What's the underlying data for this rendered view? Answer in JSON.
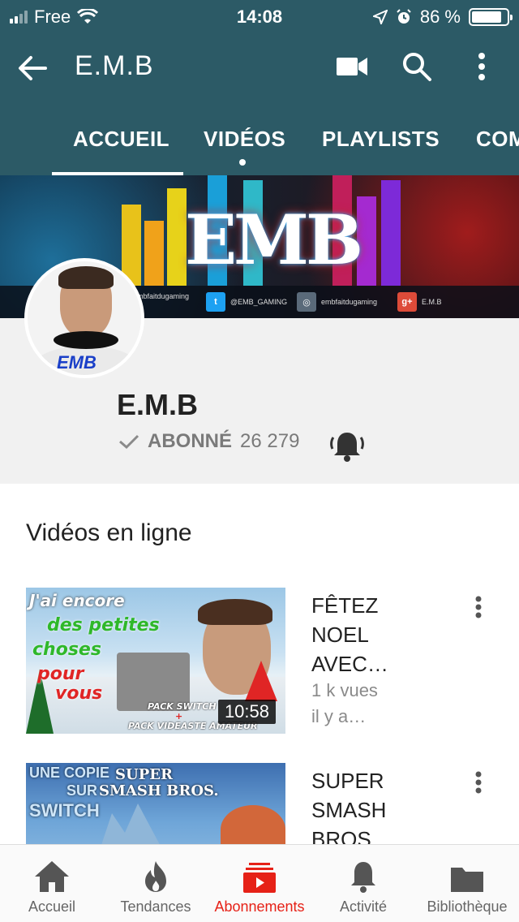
{
  "status_bar": {
    "carrier": "Free",
    "time": "14:08",
    "battery_percent": "86 %",
    "battery_level": 0.86
  },
  "app_bar": {
    "title": "E.M.B",
    "icons": [
      "back-arrow-icon",
      "video-camera-icon",
      "search-icon",
      "more-vert-icon"
    ]
  },
  "tabs": [
    {
      "label": "ACCUEIL",
      "active": true
    },
    {
      "label": "VIDÉOS",
      "has_dot": true
    },
    {
      "label": "PLAYLISTS"
    },
    {
      "label": "COM"
    }
  ],
  "banner": {
    "logo_text": "EMB",
    "socials": [
      {
        "icon": "facebook-icon",
        "handle": "embfaitdugaming"
      },
      {
        "icon": "twitter-icon",
        "handle": "@EMB_GAMING"
      },
      {
        "icon": "instagram-icon",
        "handle": "embfaitdugaming"
      },
      {
        "icon": "google-plus-icon",
        "handle": "E.M.B"
      }
    ]
  },
  "channel": {
    "name": "E.M.B",
    "avatar_logo": "EMB",
    "subscribed_label": "ABONNÉ",
    "subscriber_count": "26 279"
  },
  "section": {
    "title": "Vidéos en ligne"
  },
  "videos": [
    {
      "title_lines": [
        "FÊTEZ",
        "NOEL",
        "AVEC…"
      ],
      "views": "1 k vues",
      "age": "il y a…",
      "duration": "10:58",
      "thumb_text": [
        "J'ai encore",
        "des petites",
        "choses",
        "pour",
        "vous"
      ],
      "thumb_caption": [
        "PACK SWITCH",
        "+",
        "PACK VIDEASTE AMATEUR"
      ]
    },
    {
      "title_lines": [
        "SUPER",
        "SMASH",
        "BROS…"
      ],
      "thumb_text": [
        "UNE COPIE",
        "SUR",
        "SWITCH"
      ],
      "thumb_logo": [
        "SUPER",
        "SMASH BROS."
      ]
    }
  ],
  "bottom_nav": [
    {
      "label": "Accueil",
      "icon": "home-icon"
    },
    {
      "label": "Tendances",
      "icon": "flame-icon"
    },
    {
      "label": "Abonnements",
      "icon": "subscriptions-icon",
      "active": true
    },
    {
      "label": "Activité",
      "icon": "bell-icon"
    },
    {
      "label": "Bibliothèque",
      "icon": "folder-icon"
    }
  ],
  "colors": {
    "app_bar": "#2c5a66",
    "active": "#e62117",
    "channel_bg": "#f1f1f1"
  }
}
